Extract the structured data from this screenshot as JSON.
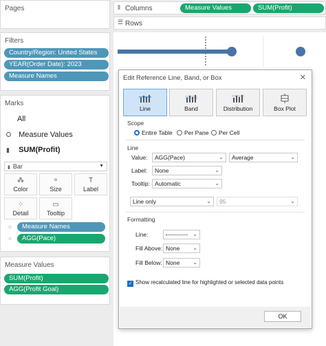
{
  "pages": {
    "title": "Pages"
  },
  "filters": {
    "title": "Filters",
    "items": [
      "Country/Region: United States",
      "YEAR(Order Date): 2023",
      "Measure Names"
    ]
  },
  "marks": {
    "title": "Marks",
    "all": "All",
    "measure_values": "Measure Values",
    "sum_profit": "SUM(Profit)",
    "mark_type": "Bar",
    "buttons": {
      "color": "Color",
      "size": "Size",
      "label": "Label",
      "detail": "Detail",
      "tooltip": "Tooltip"
    },
    "pills": [
      "Measure Names",
      "AGG(Pace)"
    ]
  },
  "measure_values_card": {
    "title": "Measure Values",
    "pills": [
      "SUM(Profit)",
      "AGG(Profit Goal)"
    ]
  },
  "shelves": {
    "columns_label": "Columns",
    "rows_label": "Rows",
    "column_pills": [
      "Measure Values",
      "SUM(Profit)"
    ]
  },
  "dialog": {
    "title": "Edit Reference Line, Band, or Box",
    "close": "✕",
    "types": [
      "Line",
      "Band",
      "Distribution",
      "Box Plot"
    ],
    "scope": {
      "title": "Scope",
      "options": [
        "Entire Table",
        "Per Pane",
        "Per Cell"
      ],
      "selected": "Entire Table"
    },
    "line": {
      "title": "Line",
      "value_label": "Value:",
      "value": "AGG(Pace)",
      "aggregation": "Average",
      "label_label": "Label:",
      "label": "None",
      "tooltip_label": "Tooltip:",
      "tooltip": "Automatic",
      "line_only": "Line only",
      "percent": "95"
    },
    "formatting": {
      "title": "Formatting",
      "line_label": "Line:",
      "fill_above_label": "Fill Above:",
      "fill_above": "None",
      "fill_below_label": "Fill Below:",
      "fill_below": "None"
    },
    "checkbox": "Show recalculated line for highlighted or selected data points",
    "ok": "OK"
  },
  "colors": {
    "blue_pill": "#4e97b9",
    "green_pill": "#1aa76f",
    "accent": "#1b6ec2",
    "bar": "#4a74a8"
  }
}
